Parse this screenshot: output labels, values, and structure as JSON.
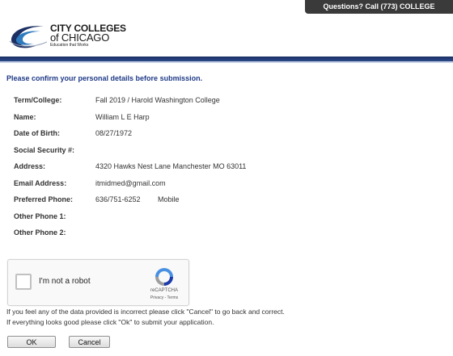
{
  "header": {
    "help_text": "Questions? Call (773) COLLEGE",
    "logo": {
      "line1": "CITY COLLEGES",
      "line2": "of CHICAGO",
      "tagline": "Education that Works"
    },
    "colors": {
      "brand_navy": "#1b2f63",
      "title_blue": "#1f3a87"
    }
  },
  "confirm": {
    "title": "Please confirm your personal details before submission.",
    "fields": [
      {
        "label": "Term/College:",
        "value": "Fall 2019 / Harold Washington College",
        "extra": ""
      },
      {
        "label": "Name:",
        "value": "William L E Harp",
        "extra": ""
      },
      {
        "label": "Date of Birth:",
        "value": "08/27/1972",
        "extra": ""
      },
      {
        "label": "Social Security #:",
        "value": "",
        "extra": ""
      },
      {
        "label": "Address:",
        "value": "4320  Hawks Nest Lane Manchester MO 63011",
        "extra": ""
      },
      {
        "label": "Email Address:",
        "value": "itmidmed@gmail.com",
        "extra": ""
      },
      {
        "label": "Preferred Phone:",
        "value": "636/751-6252",
        "extra": "Mobile"
      },
      {
        "label": "Other Phone 1:",
        "value": "",
        "extra": ""
      },
      {
        "label": "Other Phone 2:",
        "value": "",
        "extra": ""
      }
    ]
  },
  "recaptcha": {
    "label": "I'm not a robot",
    "brand": "reCAPTCHA",
    "links": "Privacy - Terms",
    "checked": false
  },
  "messages": {
    "line1": "If you feel any of the data provided is incorrect please click \"Cancel\" to go back and correct.",
    "line2": "If everything looks good please click \"Ok\" to submit your application."
  },
  "buttons": {
    "ok": "OK",
    "cancel": "Cancel"
  }
}
